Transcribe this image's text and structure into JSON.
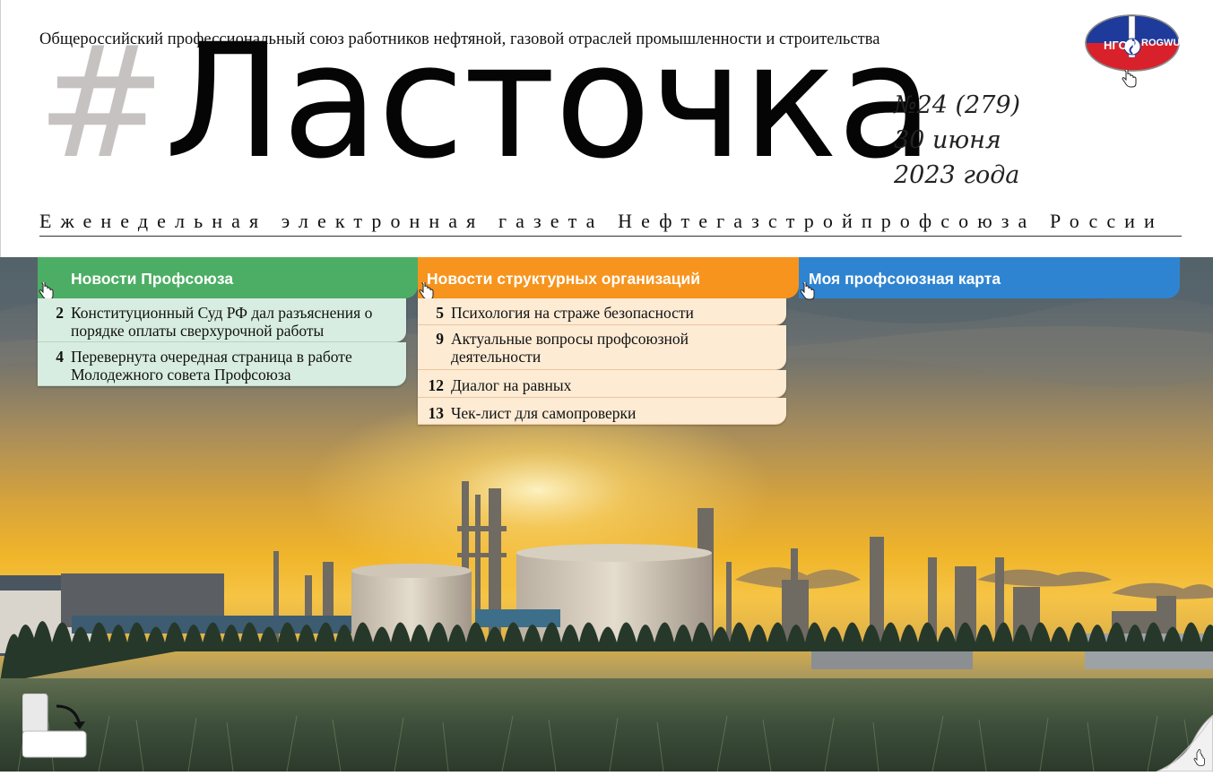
{
  "header": {
    "union_name": "Общероссийский профессиональный союз работников нефтяной, газовой отраслей промышленности и строительства",
    "title_hash": "#",
    "title_name": "Ласточка",
    "issue_number": "№24 (279)",
    "issue_day": "30 июня",
    "issue_year": "2023 года",
    "tagline": "Еженедельная электронная газета Нефтегазстройпрофсоюза России",
    "logo": {
      "left_text": "НГСП",
      "right_text": "ROGWU"
    }
  },
  "tabs": [
    {
      "label": "Новости Профсоюза",
      "color": "#4cae64"
    },
    {
      "label": "Новости структурных организаций",
      "color": "#f7941d"
    },
    {
      "label": "Моя профсоюзная карта",
      "color": "#2f84d1"
    }
  ],
  "union_news": [
    {
      "page": "2",
      "title": "Конституционный Суд РФ дал разъяснения о порядке оплаты сверхурочной работы"
    },
    {
      "page": "4",
      "title": "Перевернута очередная страница в работе Молодежного совета Профсоюза"
    }
  ],
  "org_news": [
    {
      "page": "5",
      "title": "Психология на страже безопасности"
    },
    {
      "page": "9",
      "title": "Актуальные вопросы профсоюзной деятельности"
    },
    {
      "page": "12",
      "title": "Диалог на равных"
    },
    {
      "page": "13",
      "title": "Чек-лист для самопроверки"
    }
  ],
  "icons": {
    "rotate": "rotate-icon",
    "page_curl": "page-curl-icon",
    "hand_cursor": "hand-cursor-icon"
  }
}
